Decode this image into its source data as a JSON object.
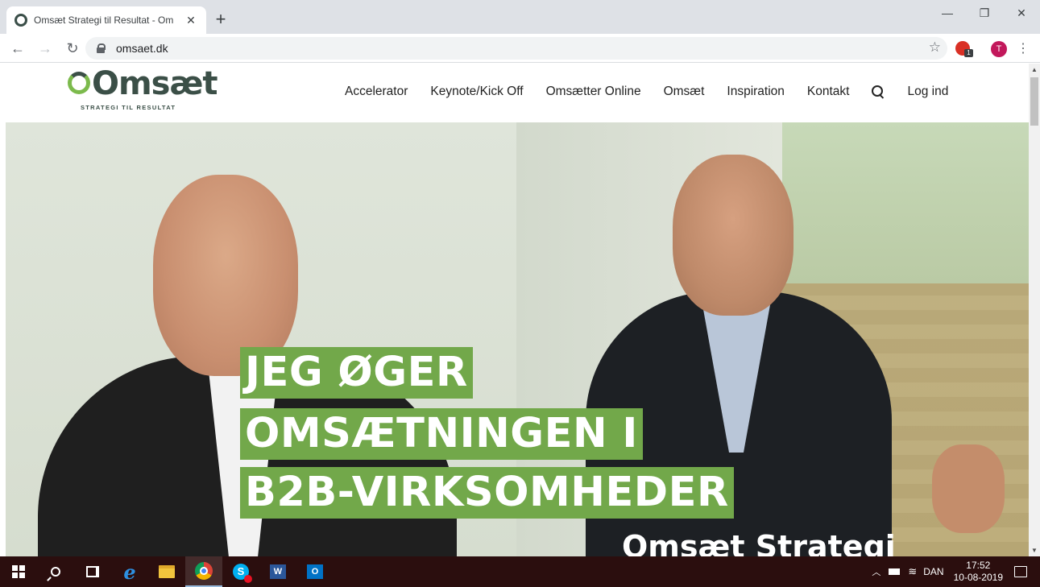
{
  "browser": {
    "tab_title": "Omsæt Strategi til Resultat - Om",
    "tab_close": "✕",
    "new_tab": "+",
    "url": "omsaet.dk",
    "profile_initial": "T",
    "ext_badge": "1",
    "window_controls": {
      "minimize": "—",
      "restore": "❐",
      "close": "✕"
    }
  },
  "site": {
    "logo": {
      "name": "Omsæt",
      "tagline": "STRATEGI TIL RESULTAT"
    },
    "nav": [
      "Accelerator",
      "Keynote/Kick Off",
      "Omsætter Online",
      "Omsæt",
      "Inspiration",
      "Kontakt"
    ],
    "login": "Log ind"
  },
  "hero": {
    "lines": [
      "JEG ØGER",
      "OMSÆTNINGEN I",
      "B2B-VIRKSOMHEDER"
    ],
    "subtitle": "Omsæt Strategi"
  },
  "taskbar": {
    "word_label": "W",
    "outlook_label": "O",
    "skype_label": "S",
    "language": "DAN",
    "time": "17:52",
    "date": "10-08-2019"
  },
  "colors": {
    "brand_green": "#72a84a",
    "brand_dark": "#3b4f47",
    "taskbar": "#2b0e0e"
  }
}
